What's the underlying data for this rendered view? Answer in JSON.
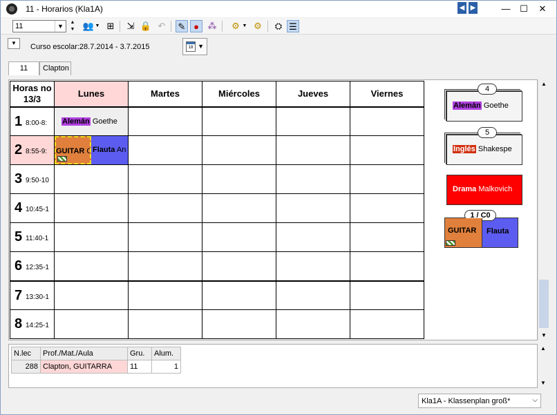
{
  "window": {
    "title": "11 -   Horarios  (Kla1A)",
    "nav_prev": "◀",
    "nav_next": "▶",
    "minimize": "—",
    "maximize": "☐",
    "close": "✕"
  },
  "toolbar": {
    "class_select_value": "11"
  },
  "info": {
    "school_year": "Curso escolar:28.7.2014 - 3.7.2015"
  },
  "tabs": [
    {
      "label": "11"
    },
    {
      "label": "Clapton"
    }
  ],
  "timetable": {
    "corner_line1": "Horas no",
    "corner_line2": "13/3",
    "days": [
      "Lunes",
      "Martes",
      "Miércoles",
      "Jueves",
      "Viernes"
    ],
    "periods": [
      {
        "num": "1",
        "time": "8:00-8:"
      },
      {
        "num": "2",
        "time": "8:55-9:"
      },
      {
        "num": "3",
        "time": "9:50-10"
      },
      {
        "num": "4",
        "time": "10:45-1"
      },
      {
        "num": "5",
        "time": "11:40-1"
      },
      {
        "num": "6",
        "time": "12:35-1"
      },
      {
        "num": "7",
        "time": "13:30-1"
      },
      {
        "num": "8",
        "time": "14:25-1"
      }
    ],
    "lesson_p1_mon": {
      "subject": "Alemán",
      "teacher": "Goethe"
    },
    "lesson_p2_mon_left": {
      "subject": "GUITAR",
      "teacher": "C"
    },
    "lesson_p2_mon_right": {
      "subject": "Flauta",
      "teacher": "An"
    }
  },
  "unscheduled": [
    {
      "badge": "4",
      "subject": "Alemán",
      "teacher": "Goethe"
    },
    {
      "badge": "5",
      "subject": "Inglés",
      "teacher": "Shakespe"
    },
    {
      "subject": "Drama",
      "teacher": "Malkovich"
    },
    {
      "badge": "1 / C0",
      "left": "GUITAR",
      "right": "Flauta"
    }
  ],
  "lessons_table": {
    "headers": [
      "N.lec",
      "Prof./Mat./Aula",
      "Gru.",
      "Alum."
    ],
    "rows": [
      {
        "n": "288",
        "desc": "Clapton, GUITARRA",
        "group": "11",
        "students": "1"
      }
    ]
  },
  "status": {
    "format_value": "Kla1A - Klassenplan groß*"
  },
  "colors": {
    "highlight_pink": "#ffd7d7",
    "subject_purple": "#b040e0",
    "subject_red": "#d03010",
    "guitar_orange": "#e0803c",
    "flute_blue": "#5c5cf0",
    "drama_red": "#ff0000"
  }
}
